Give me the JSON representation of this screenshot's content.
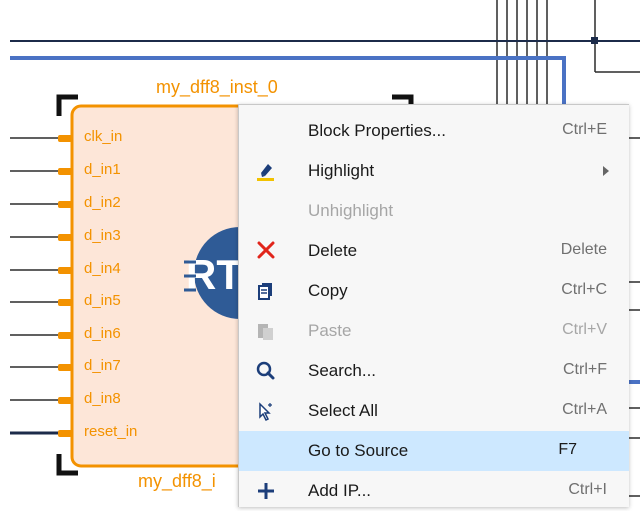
{
  "canvas": {
    "block_name_top": "my_dff8_inst_0",
    "block_name_bottom": "my_dff8_i",
    "logo_text": "RT",
    "pins": [
      "clk_in",
      "d_in1",
      "d_in2",
      "d_in3",
      "d_in4",
      "d_in5",
      "d_in6",
      "d_in7",
      "d_in8",
      "reset_in"
    ]
  },
  "colors": {
    "accent_orange": "#f39200",
    "block_fill": "#fde6d8",
    "wire_blue": "#4a72c4",
    "selection": "#cde8ff"
  },
  "context_menu": {
    "items": [
      {
        "label": "Block Properties...",
        "shortcut": "Ctrl+E",
        "icon": "none",
        "enabled": true
      },
      {
        "label": "Highlight",
        "shortcut": "",
        "icon": "highlighter-icon",
        "enabled": true,
        "submenu": true
      },
      {
        "label": "Unhighlight",
        "shortcut": "",
        "icon": "none",
        "enabled": false
      },
      {
        "label": "Delete",
        "shortcut": "Delete",
        "icon": "delete-x-icon",
        "enabled": true
      },
      {
        "label": "Copy",
        "shortcut": "Ctrl+C",
        "icon": "copy-icon",
        "enabled": true
      },
      {
        "label": "Paste",
        "shortcut": "Ctrl+V",
        "icon": "paste-icon",
        "enabled": false
      },
      {
        "label": "Search...",
        "shortcut": "Ctrl+F",
        "icon": "search-icon",
        "enabled": true
      },
      {
        "label": "Select All",
        "shortcut": "Ctrl+A",
        "icon": "select-all-icon",
        "enabled": true
      },
      {
        "label": "Go to Source",
        "shortcut": "F7",
        "icon": "none",
        "enabled": true,
        "selected": true
      },
      {
        "label": "Add IP...",
        "shortcut": "Ctrl+I",
        "icon": "add-icon",
        "enabled": true
      }
    ]
  }
}
